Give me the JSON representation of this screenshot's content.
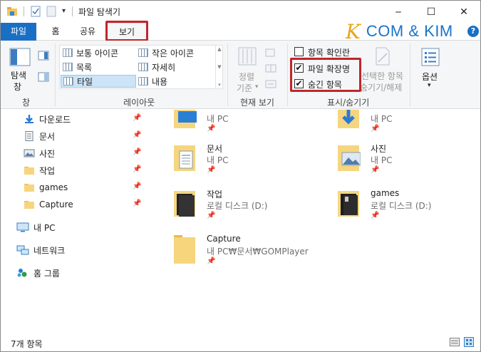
{
  "titlebar": {
    "title": "파일 탐색기",
    "minimize_glyph": "─",
    "maximize_glyph": "☐",
    "close_glyph": "✕",
    "quick_access_dropdown_glyph": "▾"
  },
  "tabs": [
    {
      "label": "파일",
      "active": false
    },
    {
      "label": "홈",
      "active": false
    },
    {
      "label": "공유",
      "active": false
    },
    {
      "label": "보기",
      "active": true
    }
  ],
  "logo": {
    "letter": "K",
    "text": "COM & KIM"
  },
  "help_glyph": "?",
  "ribbon": {
    "pane": {
      "nav_pane_label_1": "탐색",
      "nav_pane_label_2": "창",
      "group_label": "창"
    },
    "layout": {
      "group_label": "레이아웃",
      "items": [
        "보통 아이콘",
        "작은 아이콘",
        "목록",
        "자세히",
        "타일",
        "내용"
      ],
      "selected": "타일",
      "scroll_up": "▲",
      "scroll_down": "▼",
      "scroll_more": "▾"
    },
    "current_view": {
      "sort_label_1": "정렬",
      "sort_label_2": "기준",
      "group_label": "현재 보기",
      "dropdown_glyph": "▾"
    },
    "show_hide": {
      "group_label": "표시/숨기기",
      "item_checkboxes": {
        "label": "항목 확인란",
        "checked": false
      },
      "file_extensions": {
        "label": "파일 확장명",
        "checked": true
      },
      "hidden_items": {
        "label": "숨긴 항목",
        "checked": true
      },
      "hide_selected_1": "선택한 항목",
      "hide_selected_2": "숨기기/해제",
      "check_glyph": "✔"
    },
    "options": {
      "label": "옵션",
      "dropdown_glyph": "▾"
    }
  },
  "nav": {
    "pin_glyph": "📌",
    "items": [
      {
        "label": "다운로드",
        "icon": "download-icon",
        "pinned": true
      },
      {
        "label": "문서",
        "icon": "document-icon",
        "pinned": true
      },
      {
        "label": "사진",
        "icon": "picture-icon",
        "pinned": true
      },
      {
        "label": "작업",
        "icon": "folder-icon",
        "pinned": true
      },
      {
        "label": "games",
        "icon": "folder-icon",
        "pinned": true
      },
      {
        "label": "Capture",
        "icon": "folder-icon",
        "pinned": true
      },
      {
        "label": "내 PC",
        "icon": "pc-icon",
        "pinned": false
      },
      {
        "label": "네트워크",
        "icon": "network-icon",
        "pinned": false
      },
      {
        "label": "홈 그룹",
        "icon": "homegroup-icon",
        "pinned": false
      }
    ]
  },
  "content": {
    "pin_glyph": "📌",
    "tiles": [
      {
        "name": "",
        "sub": "내 PC",
        "icon": "desktop-folder-icon"
      },
      {
        "name": "",
        "sub": "내 PC",
        "icon": "downloads-folder-icon"
      },
      {
        "name": "문서",
        "sub": "내 PC",
        "icon": "documents-folder-icon"
      },
      {
        "name": "사진",
        "sub": "내 PC",
        "icon": "pictures-folder-icon"
      },
      {
        "name": "작업",
        "sub": "로컬 디스크 (D:)",
        "icon": "folder-icon"
      },
      {
        "name": "games",
        "sub": "로컬 디스크 (D:)",
        "icon": "folder-icon"
      },
      {
        "name": "Capture",
        "sub": "내 PC₩문서₩GOMPlayer",
        "icon": "folder-icon"
      }
    ]
  },
  "status": {
    "count_text": "7개 항목"
  }
}
